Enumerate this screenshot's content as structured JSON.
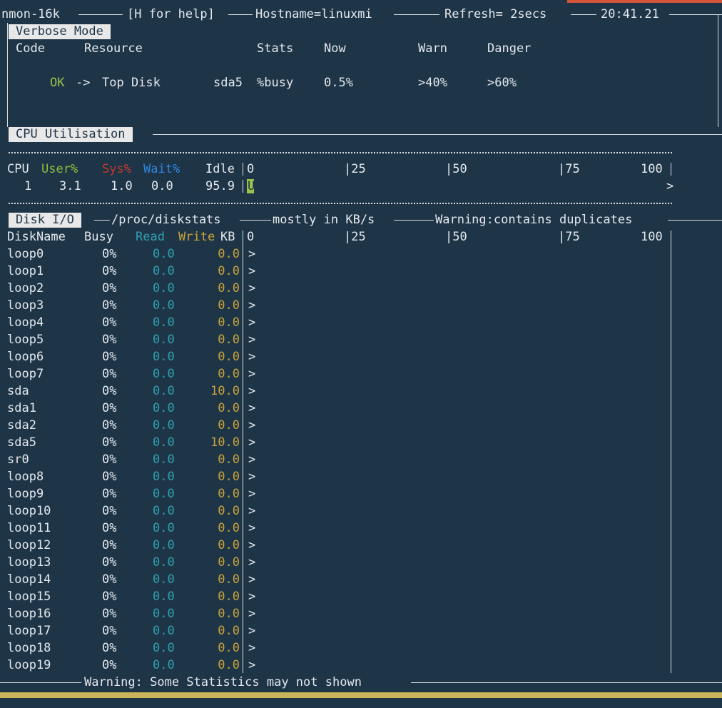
{
  "header": {
    "app": "nmon-16k",
    "help": "[H for help]",
    "hostname": "Hostname=linuxmi",
    "refresh": "Refresh= 2secs",
    "time": "20:41.21"
  },
  "verbose": {
    "tab": "Verbose Mode",
    "headers": [
      "Code",
      "Resource",
      "Stats",
      "Now",
      "Warn",
      "Danger"
    ],
    "row": {
      "code": "OK",
      "arrow": "->",
      "resource": "Top Disk",
      "disk": "sda5",
      "stat": "%busy",
      "now": "0.5%",
      "warn": ">40%",
      "danger": ">60%"
    }
  },
  "cpu": {
    "tab": "CPU Utilisation",
    "headers": {
      "cpu": "CPU",
      "user": "User%",
      "sys": "Sys%",
      "wait": "Wait%",
      "idle": "Idle"
    },
    "scale": [
      "0",
      "|25",
      "|50",
      "|75",
      "100"
    ],
    "row": {
      "cpu": "1",
      "user": "3.1",
      "sys": "1.0",
      "wait": "0.0",
      "idle": "95.9",
      "bar_char": "U",
      "end": ">"
    }
  },
  "disk": {
    "tab": "Disk I/O",
    "source": "/proc/diskstats",
    "units": "mostly in KB/s",
    "warning": "Warning:contains duplicates",
    "headers": {
      "name": "DiskName",
      "busy": "Busy",
      "read": "Read",
      "write": "Write",
      "kb": "KB"
    },
    "scale": [
      "0",
      "|25",
      "|50",
      "|75",
      "100"
    ],
    "rows": [
      {
        "name": "loop0",
        "busy": "0%",
        "read": "0.0",
        "write": "0.0"
      },
      {
        "name": "loop1",
        "busy": "0%",
        "read": "0.0",
        "write": "0.0"
      },
      {
        "name": "loop2",
        "busy": "0%",
        "read": "0.0",
        "write": "0.0"
      },
      {
        "name": "loop3",
        "busy": "0%",
        "read": "0.0",
        "write": "0.0"
      },
      {
        "name": "loop4",
        "busy": "0%",
        "read": "0.0",
        "write": "0.0"
      },
      {
        "name": "loop5",
        "busy": "0%",
        "read": "0.0",
        "write": "0.0"
      },
      {
        "name": "loop6",
        "busy": "0%",
        "read": "0.0",
        "write": "0.0"
      },
      {
        "name": "loop7",
        "busy": "0%",
        "read": "0.0",
        "write": "0.0"
      },
      {
        "name": "sda",
        "busy": "0%",
        "read": "0.0",
        "write": "10.0"
      },
      {
        "name": "sda1",
        "busy": "0%",
        "read": "0.0",
        "write": "0.0"
      },
      {
        "name": "sda2",
        "busy": "0%",
        "read": "0.0",
        "write": "0.0"
      },
      {
        "name": "sda5",
        "busy": "0%",
        "read": "0.0",
        "write": "10.0"
      },
      {
        "name": "sr0",
        "busy": "0%",
        "read": "0.0",
        "write": "0.0"
      },
      {
        "name": "loop8",
        "busy": "0%",
        "read": "0.0",
        "write": "0.0"
      },
      {
        "name": "loop9",
        "busy": "0%",
        "read": "0.0",
        "write": "0.0"
      },
      {
        "name": "loop10",
        "busy": "0%",
        "read": "0.0",
        "write": "0.0"
      },
      {
        "name": "loop11",
        "busy": "0%",
        "read": "0.0",
        "write": "0.0"
      },
      {
        "name": "loop12",
        "busy": "0%",
        "read": "0.0",
        "write": "0.0"
      },
      {
        "name": "loop13",
        "busy": "0%",
        "read": "0.0",
        "write": "0.0"
      },
      {
        "name": "loop14",
        "busy": "0%",
        "read": "0.0",
        "write": "0.0"
      },
      {
        "name": "loop15",
        "busy": "0%",
        "read": "0.0",
        "write": "0.0"
      },
      {
        "name": "loop16",
        "busy": "0%",
        "read": "0.0",
        "write": "0.0"
      },
      {
        "name": "loop17",
        "busy": "0%",
        "read": "0.0",
        "write": "0.0"
      },
      {
        "name": "loop18",
        "busy": "0%",
        "read": "0.0",
        "write": "0.0"
      },
      {
        "name": "loop19",
        "busy": "0%",
        "read": "0.0",
        "write": "0.0"
      }
    ],
    "row_end": ">",
    "footer": "Warning: Some Statistics may not shown"
  },
  "colors": {
    "background": "#1e3548",
    "ok": "#9bc34a",
    "user": "#8bbd3a",
    "sys": "#c0392b",
    "wait": "#2e86de",
    "read": "#2f9fae",
    "write": "#c9a33a"
  }
}
